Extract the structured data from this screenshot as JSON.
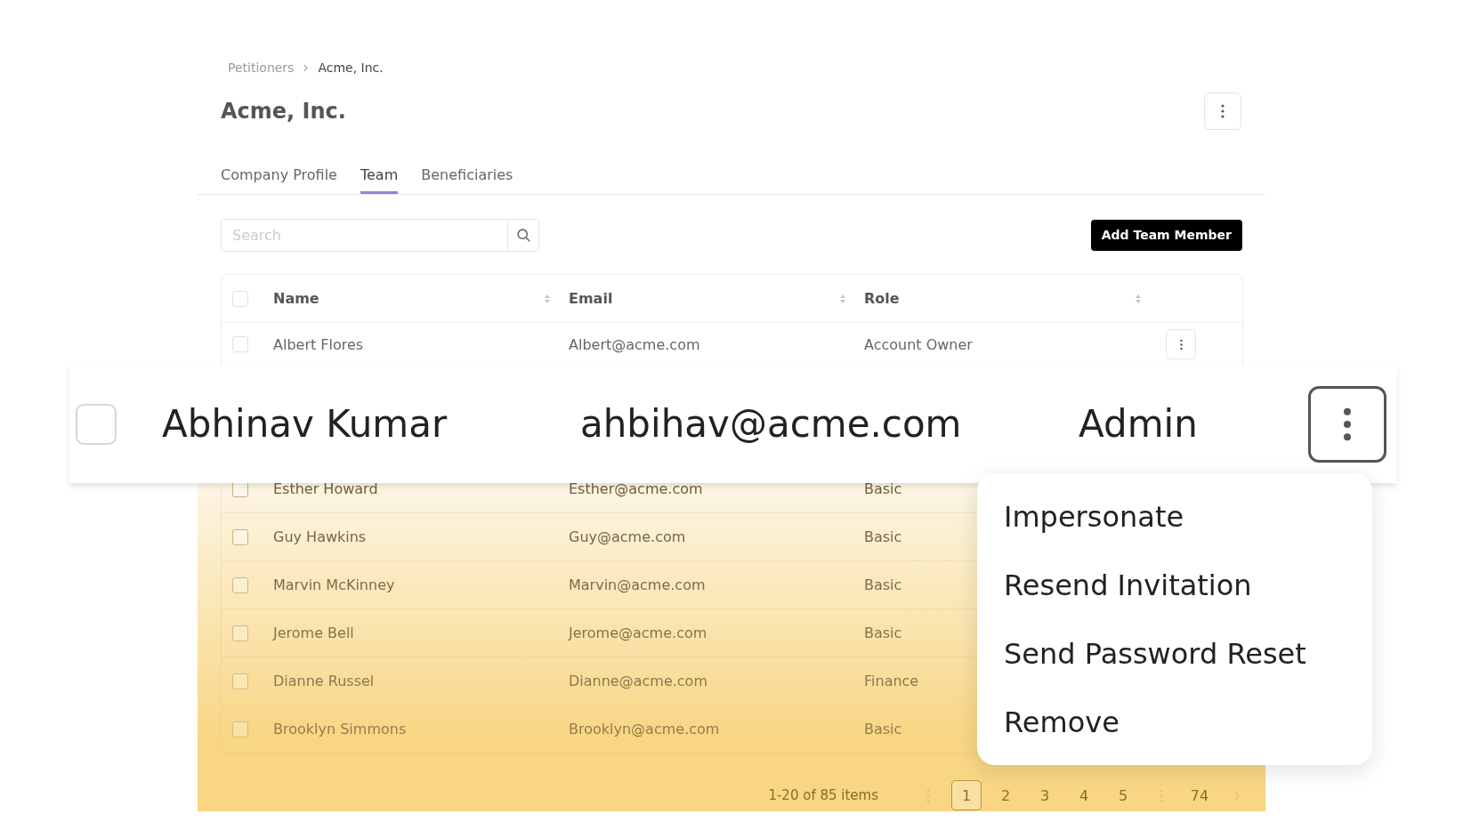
{
  "breadcrumb": [
    "Petitioners",
    "Acme, Inc."
  ],
  "title": "Acme, Inc.",
  "tabs": [
    {
      "label": "Company Profile",
      "selected": false
    },
    {
      "label": "Team",
      "selected": true
    },
    {
      "label": "Beneficiaries",
      "selected": false
    }
  ],
  "search": {
    "placeholder": "Search"
  },
  "add_button": "Add Team Member",
  "table": {
    "columns": [
      "Name",
      "Email",
      "Role"
    ],
    "select_all_checked": false,
    "rows": [
      {
        "kind": "plain",
        "name": "Albert Flores",
        "email": "Albert@acme.com",
        "role": "Account Owner",
        "checked": false
      },
      {
        "kind": "faded",
        "name": "Esther Howard",
        "email": "Esther@acme.com",
        "role": "Basic",
        "checked": false
      },
      {
        "kind": "faded",
        "name": "Guy Hawkins",
        "email": "Guy@acme.com",
        "role": "Basic",
        "checked": false
      },
      {
        "kind": "faded",
        "name": "Marvin McKinney",
        "email": "Marvin@acme.com",
        "role": "Basic",
        "checked": false
      },
      {
        "kind": "faded",
        "name": "Jerome Bell",
        "email": "Jerome@acme.com",
        "role": "Basic",
        "checked": false
      },
      {
        "kind": "faded",
        "name": "Dianne Russel",
        "email": "Dianne@acme.com",
        "role": "Finance",
        "checked": false
      },
      {
        "kind": "faded",
        "name": "Brooklyn Simmons",
        "email": "Brooklyn@acme.com",
        "role": "Basic",
        "checked": false
      }
    ]
  },
  "highlighted_row": {
    "name": "Abhinav Kumar",
    "email": "ahbihav@acme.com",
    "role": "Admin",
    "checked": false
  },
  "menu": [
    "Impersonate",
    "Resend Invitation",
    "Send Password Reset",
    "Remove"
  ],
  "pagination": {
    "summary": "1-20 of 85 items",
    "pages": [
      {
        "kind": "page",
        "label": "1",
        "selected": true
      },
      {
        "kind": "page",
        "label": "2",
        "selected": false
      },
      {
        "kind": "page",
        "label": "3",
        "selected": false
      },
      {
        "kind": "page",
        "label": "4",
        "selected": false
      },
      {
        "kind": "page",
        "label": "5",
        "selected": false
      },
      {
        "kind": "gap"
      },
      {
        "kind": "page",
        "label": "74",
        "selected": false
      }
    ]
  }
}
